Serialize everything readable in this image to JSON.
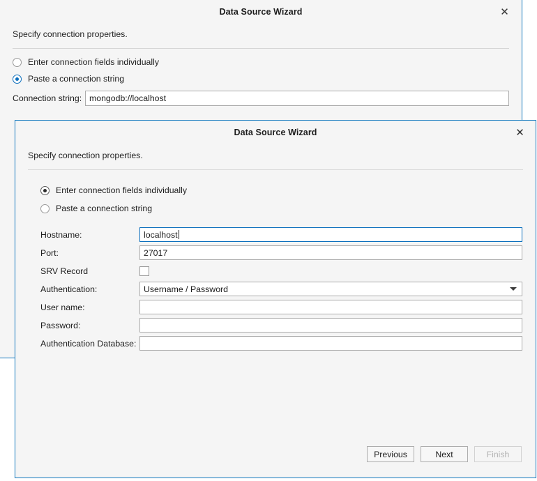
{
  "background_window": {
    "title": "Data Source Wizard",
    "close_icon": "close-icon",
    "subtitle": "Specify connection properties.",
    "options": [
      {
        "label": "Enter connection fields individually",
        "selected": false
      },
      {
        "label": "Paste a connection string",
        "selected": true
      }
    ],
    "connection_string": {
      "label": "Connection string:",
      "value": "mongodb://localhost"
    }
  },
  "foreground_dialog": {
    "title": "Data Source Wizard",
    "close_icon": "close-icon",
    "subtitle": "Specify connection properties.",
    "options": [
      {
        "label": "Enter connection fields individually",
        "selected": true
      },
      {
        "label": "Paste a connection string",
        "selected": false
      }
    ],
    "fields": {
      "hostname": {
        "label": "Hostname:",
        "value": "localhost",
        "focused": true
      },
      "port": {
        "label": "Port:",
        "value": "27017",
        "focused": false
      },
      "srv_record": {
        "label": "SRV Record",
        "checked": false
      },
      "authentication": {
        "label": "Authentication:",
        "value": "Username / Password",
        "dropdown_icon": "chevron-down-icon"
      },
      "user_name": {
        "label": "User name:",
        "value": ""
      },
      "password": {
        "label": "Password:",
        "value": ""
      },
      "auth_database": {
        "label": "Authentication Database:",
        "value": ""
      }
    },
    "buttons": {
      "previous": "Previous",
      "next": "Next",
      "finish": "Finish",
      "finish_disabled": true
    }
  },
  "colors": {
    "window_border": "#1278be",
    "accent": "#0a6ebd",
    "panel_bg": "#f5f5f5",
    "input_border": "#ababab"
  }
}
